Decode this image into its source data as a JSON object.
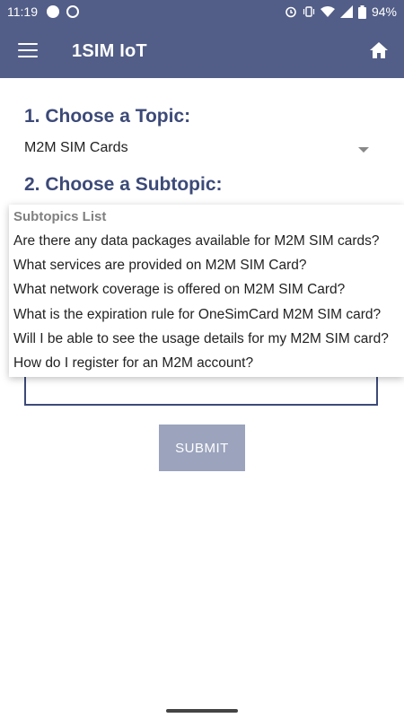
{
  "status_bar": {
    "time": "11:19",
    "battery": "94%"
  },
  "app_bar": {
    "title": "1SIM IoT"
  },
  "form": {
    "topic_heading": "1. Choose a Topic:",
    "topic_value": "M2M SIM Cards",
    "subtopic_heading": "2. Choose a Subtopic:",
    "submit_label": "SUBMIT"
  },
  "dropdown": {
    "header": "Subtopics List",
    "items": [
      "Are there any data packages available for M2M SIM cards?",
      "What services are provided on M2M SIM Card?",
      "What network coverage is offered on M2M SIM Card?",
      "What is the expiration rule for OneSimCard M2M SIM card?",
      "Will I be able to see the usage details for my M2M SIM card?",
      "How do I register for an M2M account?"
    ]
  },
  "colors": {
    "primary": "#525e87",
    "heading": "#3c4a78",
    "submit_bg": "#9ba3bd"
  }
}
